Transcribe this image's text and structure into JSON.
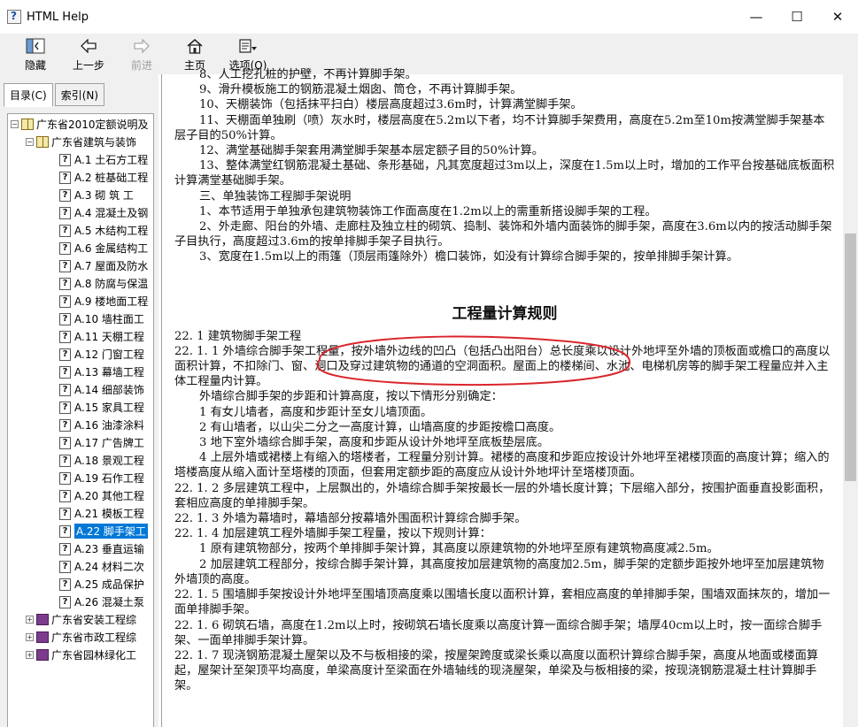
{
  "window": {
    "title": "HTML Help",
    "minimize_glyph": "—",
    "maximize_glyph": "☐",
    "close_glyph": "✕"
  },
  "toolbar": {
    "hide_label": "隐藏",
    "back_label": "上一步",
    "forward_label": "前进",
    "home_label": "主页",
    "options_label": "选项(O)"
  },
  "tabs": {
    "contents": "目录(C)",
    "index": "索引(N)"
  },
  "tree": {
    "root": "广东省2010定额说明及",
    "sub": "广东省建筑与装饰",
    "items": [
      "A.1  土石方工程",
      "A.2  桩基础工程",
      "A.3  砌  筑  工",
      "A.4  混凝土及钢",
      "A.5  木结构工程",
      "A.6  金属结构工",
      "A.7 屋面及防水",
      "A.8  防腐与保温",
      "A.9  楼地面工程",
      "A.10  墙柱面工",
      "A.11  天棚工程",
      "A.12  门窗工程",
      "A.13  幕墙工程",
      "A.14  细部装饰",
      "A.15  家具工程",
      "A.16  油漆涂料",
      "A.17  广告牌工",
      "A.18  景观工程",
      "A.19  石作工程",
      "A.20  其他工程",
      "A.21  模板工程",
      "A.22  脚手架工",
      "A.23  垂直运输",
      "A.24  材料二次",
      "A.25  成品保护",
      "A.26  混凝土泵"
    ],
    "selected_index": 21,
    "others": [
      "广东省安装工程综",
      "广东省市政工程综",
      "广东省园林绿化工"
    ]
  },
  "content": {
    "p0": "8、人工挖孔桩的护壁，不再计算脚手架。",
    "p1": "9、滑升模板施工的钢筋混凝土烟囱、筒仓，不再计算脚手架。",
    "p2": "10、天棚装饰（包括抹平扫白）楼层高度超过3.6m时，计算满堂脚手架。",
    "p3": "11、天棚面单独刷（喷）灰水时，楼层高度在5.2m以下者，均不计算脚手架费用，高度在5.2m至10m按满堂脚手架基本层子目的50%计算。",
    "p4": "12、满堂基础脚手架套用满堂脚手架基本层定额子目的50%计算。",
    "p5": "13、整体满堂红钢筋混凝土基础、条形基础，凡其宽度超过3m以上，深度在1.5m以上时，增加的工作平台按基础底板面积计算满堂基础脚手架。",
    "p6": "三、单独装饰工程脚手架说明",
    "p7": "1、本节适用于单独承包建筑物装饰工作面高度在1.2m以上的需重新搭设脚手架的工程。",
    "p8": "2、外走廊、阳台的外墙、走廊柱及独立柱的砌筑、捣制、装饰和外墙内面装饰的脚手架，高度在3.6m以内的按活动脚手架子目执行，高度超过3.6m的按单排脚手架子目执行。",
    "p9": "3、宽度在1.5m以上的雨篷（顶层雨篷除外）檐口装饰，如没有计算综合脚手架的，按单排脚手架计算。",
    "heading": "工程量计算规则",
    "r0": "22. 1  建筑物脚手架工程",
    "r1": "22. 1. 1  外墙综合脚手架工程量，按外墙外边线的凹凸（包括凸出阳台）总长度乘以设计外地坪至外墙的顶板面或檐口的高度以面积计算，不扣除门、窗、洞口及穿过建筑物的通道的空洞面积。屋面上的楼梯间、水池、电梯机房等的脚手架工程量应并入主体工程量内计算。",
    "r2": "外墙综合脚手架的步距和计算高度，按以下情形分别确定：",
    "r3": "1  有女儿墙者，高度和步距计至女儿墙顶面。",
    "r4": "2  有山墙者，以山尖二分之一高度计算，山墙高度的步距按檐口高度。",
    "r5": "3  地下室外墙综合脚手架，高度和步距从设计外地坪至底板垫层底。",
    "r6": "4  上层外墙或裙楼上有缩入的塔楼者，工程量分别计算。裙楼的高度和步距应按设计外地坪至裙楼顶面的高度计算；缩入的塔楼高度从缩入面计至塔楼的顶面，但套用定额步距的高度应从设计外地坪计至塔楼顶面。",
    "r7": "22. 1. 2  多层建筑工程中，上层飘出的，外墙综合脚手架按最长一层的外墙长度计算；下层缩入部分，按围护面垂直投影面积，套相应高度的单排脚手架。",
    "r8": "22. 1. 3  外墙为幕墙时，幕墙部分按幕墙外围面积计算综合脚手架。",
    "r9": "22. 1. 4  加层建筑工程外墙脚手架工程量，按以下规则计算：",
    "r10": "1  原有建筑物部分，按两个单排脚手架计算，其高度以原建筑物的外地坪至原有建筑物高度减2.5m。",
    "r11": "2  加层建筑工程部分，按综合脚手架计算，其高度按加层建筑物的高度加2.5m，脚手架的定额步距按外地坪至加层建筑物外墙顶的高度。",
    "r12": "22. 1. 5  围墙脚手架按设计外地坪至围墙顶高度乘以围墙长度以面积计算，套相应高度的单排脚手架，围墙双面抹灰的，增加一面单排脚手架。",
    "r13": "22. 1. 6  砌筑石墙，高度在1.2m以上时，按砌筑石墙长度乘以高度计算一面综合脚手架；墙厚40cm以上时，按一面综合脚手架、一面单排脚手架计算。",
    "r14": "22. 1. 7  现浇钢筋混凝土屋架以及不与板相接的梁，按屋架跨度或梁长乘以高度以面积计算综合脚手架，高度从地面或楼面算起，屋架计至架顶平均高度，单梁高度计至梁面在外墙轴线的现浇屋架，单梁及与板相接的梁，按现浇钢筋混凝土柱计算脚手架。"
  },
  "colors": {
    "annotation": "#d9262c",
    "selection": "#0078d7"
  }
}
